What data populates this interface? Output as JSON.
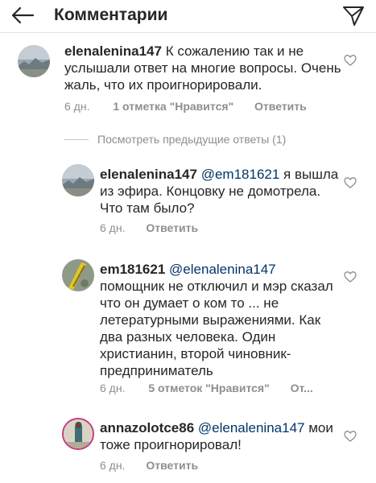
{
  "header": {
    "title": "Комментарии"
  },
  "icons": {
    "back": "arrow-left-icon",
    "direct": "paper-plane-icon",
    "like": "heart-outline-icon"
  },
  "comments": [
    {
      "username": "elenalenina147",
      "mention": "",
      "text": "К сожалению так и не услышали ответ на многие вопросы. Очень жаль, что их проигнорировали.",
      "time": "6 дн.",
      "likes": "1 отметка \"Нравится\"",
      "reply": "Ответить"
    },
    {
      "username": "elenalenina147",
      "mention": "@em181621",
      "text": "я вышла из эфира.  Концовку не домотрела. Что там было?",
      "time": "6 дн.",
      "likes": "",
      "reply": "Ответить"
    },
    {
      "username": "em181621",
      "mention": "@elenalenina147",
      "text": "помощник не отключил и мэр сказал что он думает о ком то ... не летературными выражениями. Как два разных человека. Один христианин, второй чиновник-предприниматель",
      "time": "6 дн.",
      "likes": "5 отметок \"Нравится\"",
      "reply": "От..."
    },
    {
      "username": "annazolotce86",
      "mention": "@elenalenina147",
      "text": "мои тоже проигнорировал!",
      "time": "6 дн.",
      "likes": "",
      "reply": "Ответить"
    }
  ],
  "view_previous": "Посмотреть предыдущие ответы (1)",
  "colors": {
    "text": "#262626",
    "muted": "#8e8e8e",
    "mention": "#003569",
    "divider": "#e6e6e6"
  }
}
